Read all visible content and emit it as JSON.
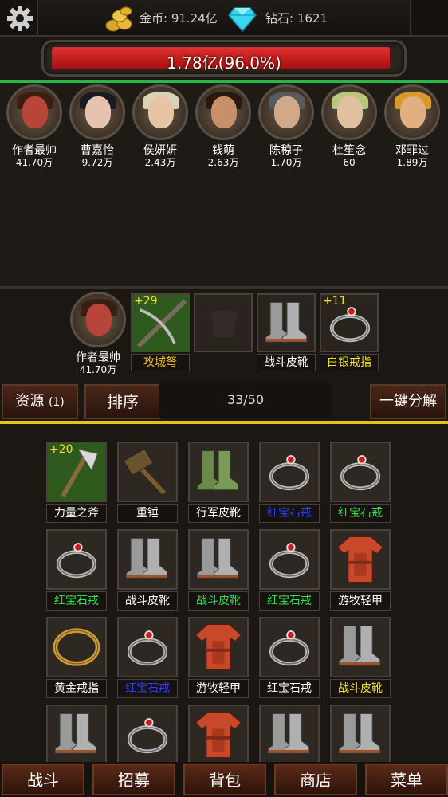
{
  "header": {
    "gold_label": "金币: 91.24亿",
    "gem_label": "钻石: 1621"
  },
  "hp": {
    "text": "1.78亿(96.0%)",
    "fraction": 0.96
  },
  "heroes": [
    {
      "name": "作者最帅",
      "value": "41.70万",
      "hair": "#3a1e10",
      "face": "#b8443a"
    },
    {
      "name": "曹嘉怡",
      "value": "9.72万",
      "hair": "#1a1a22",
      "face": "#e6c2b0"
    },
    {
      "name": "侯妍妍",
      "value": "2.43万",
      "hair": "#d8d2b8",
      "face": "#e6c4a4"
    },
    {
      "name": "钱萌",
      "value": "2.63万",
      "hair": "#2a1810",
      "face": "#c8906a"
    },
    {
      "name": "陈稤子",
      "value": "1.70万",
      "hair": "#5a5a5a",
      "face": "#d0a88a"
    },
    {
      "name": "杜笙念",
      "value": "60",
      "hair": "#b8c878",
      "face": "#e0c0a0"
    },
    {
      "name": "邓罪过",
      "value": "1.89万",
      "hair": "#d89a2a",
      "face": "#e0b080"
    }
  ],
  "selected_hero": {
    "name": "作者最帅",
    "value": "41.70万"
  },
  "equipped": [
    {
      "label": "攻城弩",
      "plus": "+29",
      "color": "gold",
      "icon": "crossbow-icon"
    },
    {
      "label": "",
      "plus": "",
      "color": "white",
      "icon": "empty-armor-slot-icon"
    },
    {
      "label": "战斗皮靴",
      "plus": "",
      "color": "white",
      "icon": "boots-icon"
    },
    {
      "label": "白银戒指",
      "plus": "+11",
      "color": "yellow",
      "icon": "ring-icon"
    }
  ],
  "toolbar": {
    "resource_label": "资源",
    "resource_count": "(1)",
    "sort_label": "排序",
    "capacity": "33/50",
    "decompose_label": "一键分解"
  },
  "inventory": [
    {
      "label": "力量之斧",
      "plus": "+20",
      "color": "white",
      "icon": "axe-icon"
    },
    {
      "label": "重锤",
      "plus": "",
      "color": "white",
      "icon": "hammer-icon"
    },
    {
      "label": "行军皮靴",
      "plus": "",
      "color": "white",
      "icon": "green-boots-icon"
    },
    {
      "label": "红宝石戒",
      "plus": "",
      "color": "blue",
      "icon": "ring-icon"
    },
    {
      "label": "红宝石戒",
      "plus": "",
      "color": "green",
      "icon": "ring-icon"
    },
    {
      "label": "红宝石戒",
      "plus": "",
      "color": "green",
      "icon": "ring-icon"
    },
    {
      "label": "战斗皮靴",
      "plus": "",
      "color": "white",
      "icon": "boots-icon"
    },
    {
      "label": "战斗皮靴",
      "plus": "",
      "color": "green",
      "icon": "boots-icon"
    },
    {
      "label": "红宝石戒",
      "plus": "",
      "color": "green",
      "icon": "ring-icon"
    },
    {
      "label": "游牧轻甲",
      "plus": "",
      "color": "white",
      "icon": "armor-icon"
    },
    {
      "label": "黄金戒指",
      "plus": "",
      "color": "white",
      "icon": "gold-ring-icon"
    },
    {
      "label": "红宝石戒",
      "plus": "",
      "color": "blue",
      "icon": "ring-icon"
    },
    {
      "label": "游牧轻甲",
      "plus": "",
      "color": "white",
      "icon": "armor-icon"
    },
    {
      "label": "红宝石戒",
      "plus": "",
      "color": "white",
      "icon": "ring-icon"
    },
    {
      "label": "战斗皮靴",
      "plus": "",
      "color": "yellow",
      "icon": "boots-icon"
    },
    {
      "label": "",
      "plus": "",
      "color": "white",
      "icon": "boots-icon"
    },
    {
      "label": "",
      "plus": "",
      "color": "white",
      "icon": "ring-icon"
    },
    {
      "label": "",
      "plus": "",
      "color": "white",
      "icon": "armor-icon"
    },
    {
      "label": "",
      "plus": "",
      "color": "white",
      "icon": "boots-icon"
    },
    {
      "label": "",
      "plus": "",
      "color": "white",
      "icon": "boots-icon"
    }
  ],
  "nav": [
    "战斗",
    "招募",
    "背包",
    "商店",
    "菜单"
  ]
}
